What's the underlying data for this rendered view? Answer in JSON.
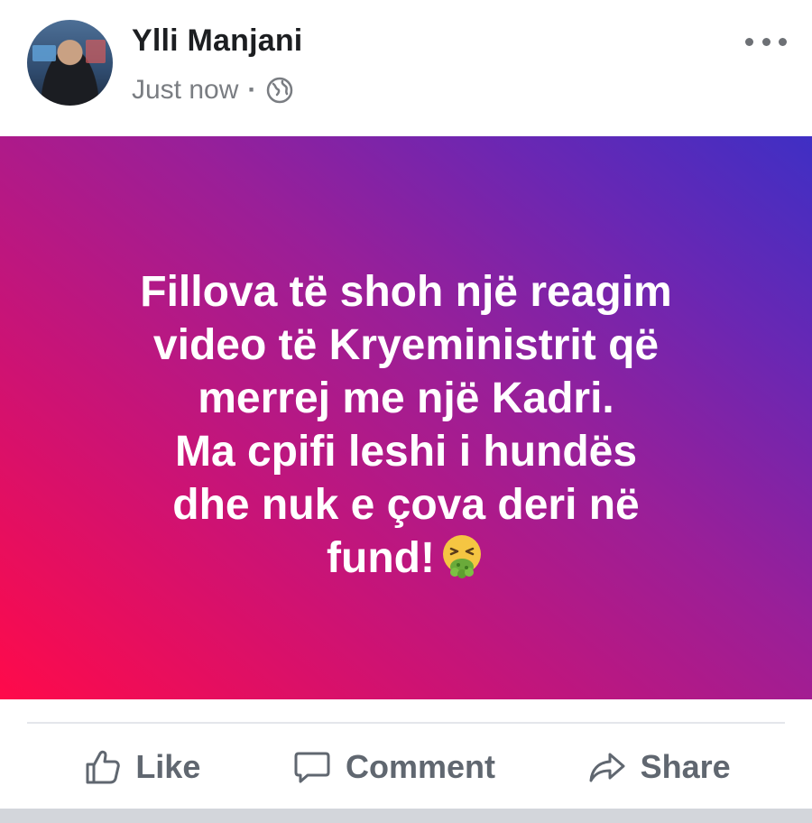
{
  "post": {
    "author": "Ylli Manjani",
    "timestamp": "Just now",
    "separator": "·",
    "privacy_icon": "globe-icon",
    "more_icon": "more-horizontal-icon",
    "text_lines": [
      "Fillova të shoh një reagim",
      "video të Kryeministrit që",
      "merrej me një Kadri.",
      "Ma cpifi leshi i hundës",
      "dhe nuk e çova deri në",
      "fund!"
    ],
    "emoji": "vomiting-face-emoji",
    "background_gradient": [
      "#ff0a4a",
      "#9a1f98",
      "#3f2fc4"
    ]
  },
  "actions": {
    "like": {
      "label": "Like",
      "icon": "thumbs-up-icon"
    },
    "comment": {
      "label": "Comment",
      "icon": "comment-bubble-icon"
    },
    "share": {
      "label": "Share",
      "icon": "share-arrow-icon"
    }
  },
  "colors": {
    "name_text": "#1c1e21",
    "meta_text": "#7a7d82",
    "action_text": "#606770"
  }
}
